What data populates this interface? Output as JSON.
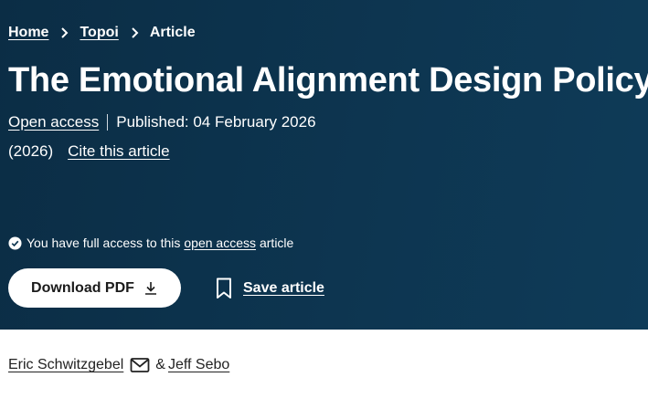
{
  "breadcrumb": {
    "items": [
      "Home",
      "Topoi"
    ],
    "current": "Article"
  },
  "article": {
    "title": "The Emotional Alignment Design Policy",
    "open_access_label": "Open access",
    "published": "Published: 04 February 2026",
    "year": "(2026)",
    "cite_label": "Cite this article"
  },
  "access_notice": {
    "prefix": "You have full access to this",
    "link": "open access",
    "suffix": "article"
  },
  "actions": {
    "download_label": "Download PDF",
    "save_label": "Save article"
  },
  "authors": {
    "first": "Eric Schwitzgebel",
    "separator": "&",
    "second": "Jeff Sebo"
  },
  "colors": {
    "hero_bg": "#0d3550",
    "text_on_hero": "#ffffff",
    "button_bg": "#ffffff"
  },
  "icons": [
    "chevron-right-icon",
    "check-circle-icon",
    "download-icon",
    "bookmark-icon",
    "mail-icon"
  ]
}
